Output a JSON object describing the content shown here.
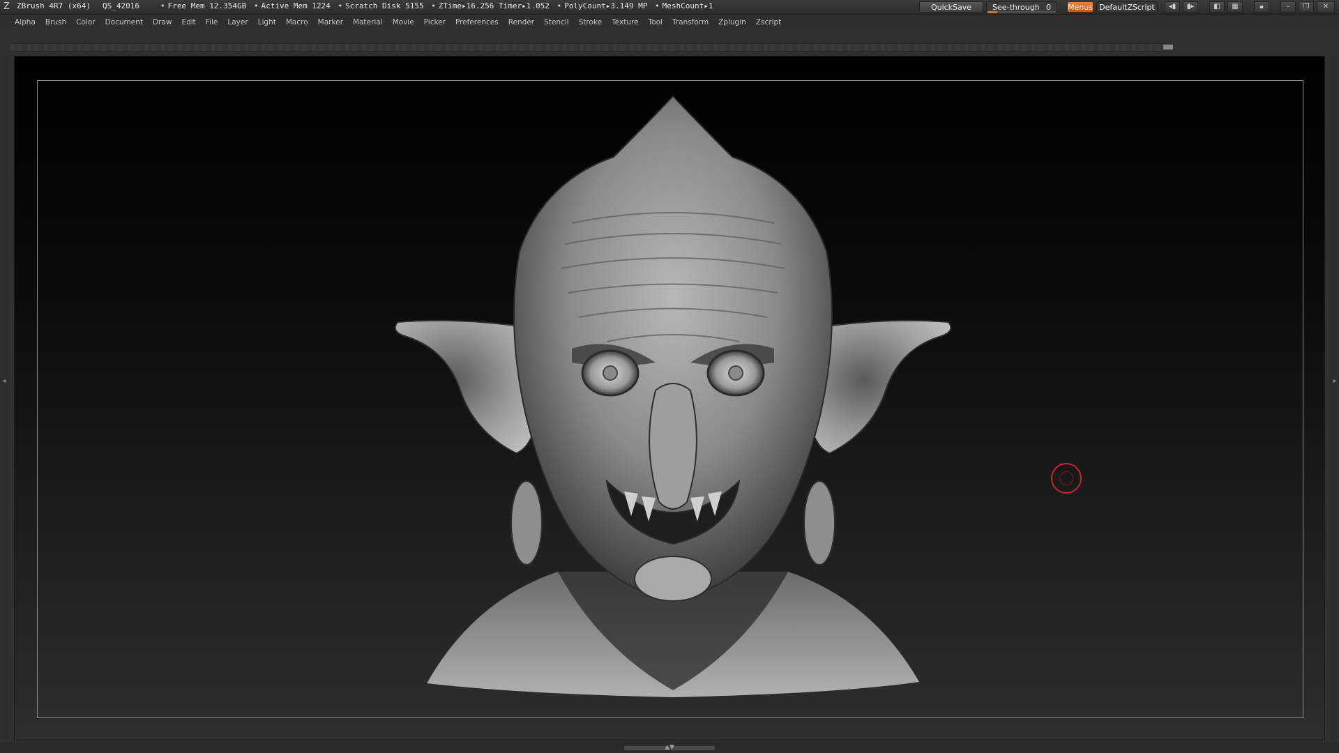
{
  "title_bar": {
    "app_name": "ZBrush 4R7 (x64)",
    "project": "QS_42016",
    "free_mem": "Free Mem 12.354GB",
    "active_mem": "Active Mem 1224",
    "scratch_disk": "Scratch Disk 5155",
    "ztime": "ZTime▸16.256",
    "timer": "Timer▸1.052",
    "polycount": "PolyCount▸3.149 MP",
    "meshcount": "MeshCount▸1",
    "quicksave_label": "QuickSave",
    "see_through_label": "See-through",
    "see_through_value": "0",
    "menus_label": "Menus",
    "script_label": "DefaultZScript"
  },
  "menu_bar": {
    "items": [
      "Alpha",
      "Brush",
      "Color",
      "Document",
      "Draw",
      "Edit",
      "File",
      "Layer",
      "Light",
      "Macro",
      "Marker",
      "Material",
      "Movie",
      "Picker",
      "Preferences",
      "Render",
      "Stencil",
      "Stroke",
      "Texture",
      "Tool",
      "Transform",
      "Zplugin",
      "Zscript"
    ]
  },
  "icons": {
    "app_logo": "zbrush-logo-icon",
    "tray_left": "chevron-left-icon",
    "tray_right": "chevron-right-icon",
    "bottom_tray": "chevron-up-down-icon",
    "lock": "lock-icon",
    "minimize": "minimize-icon",
    "restore": "restore-icon",
    "close": "close-icon"
  },
  "colors": {
    "accent": "#e36a18",
    "brush_cursor": "#c62a23",
    "frame": "#8c8c8c"
  }
}
